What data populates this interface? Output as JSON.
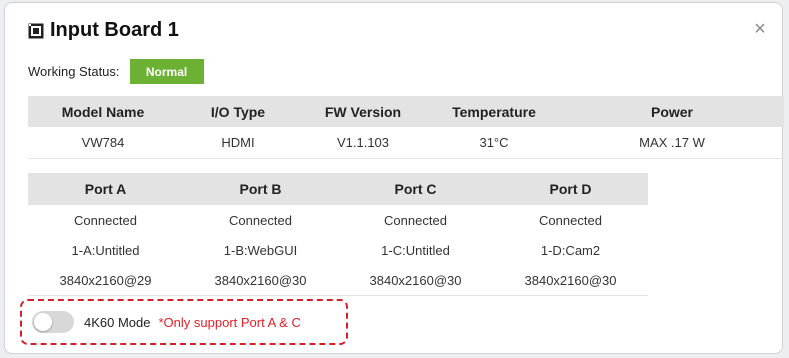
{
  "dialog": {
    "title": "Input Board 1",
    "close_symbol": "×",
    "icon": "board-icon"
  },
  "status": {
    "label": "Working Status:",
    "value": "Normal",
    "color": "#6cb133"
  },
  "info": {
    "headers": [
      "Model Name",
      "I/O Type",
      "FW Version",
      "Temperature",
      "Power"
    ],
    "row": [
      "VW784",
      "HDMI",
      "V1.1.103",
      "31°C",
      "MAX .17 W"
    ]
  },
  "ports": {
    "headers": [
      "Port A",
      "Port B",
      "Port C",
      "Port D"
    ],
    "rows": [
      [
        "Connected",
        "Connected",
        "Connected",
        "Connected"
      ],
      [
        "1-A:Untitled",
        "1-B:WebGUI",
        "1-C:Untitled",
        "1-D:Cam2"
      ],
      [
        "3840x2160@29",
        "3840x2160@30",
        "3840x2160@30",
        "3840x2160@30"
      ]
    ]
  },
  "mode": {
    "label": "4K60 Mode",
    "note": "*Only support Port A & C",
    "enabled": false,
    "highlight_color": "#d0202a"
  }
}
